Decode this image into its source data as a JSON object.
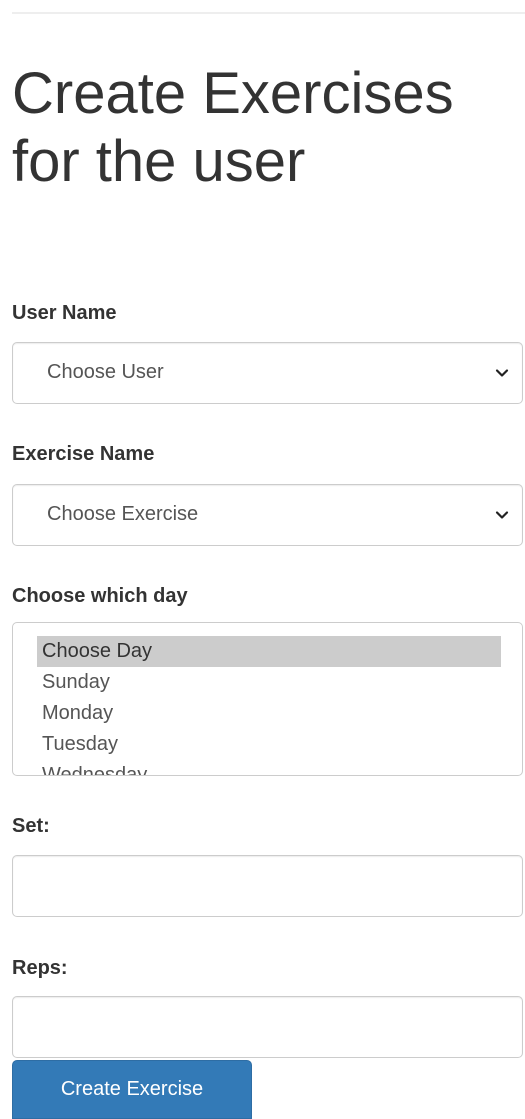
{
  "page": {
    "title": "Create Exercises for the user"
  },
  "form": {
    "user_label": "User Name",
    "user_select_value": "Choose User",
    "exercise_label": "Exercise Name",
    "exercise_select_value": "Choose Exercise",
    "day_label": "Choose which day",
    "day_options": [
      "Choose Day",
      "Sunday",
      "Monday",
      "Tuesday",
      "Wednesday"
    ],
    "day_selected": "Choose Day",
    "set_label": "Set:",
    "set_value": "",
    "reps_label": "Reps:",
    "reps_value": "",
    "submit_label": "Create Exercise"
  },
  "colors": {
    "primary": "#337ab7",
    "text": "#333333",
    "border": "#cccccc",
    "selected_option": "#cccccc"
  }
}
